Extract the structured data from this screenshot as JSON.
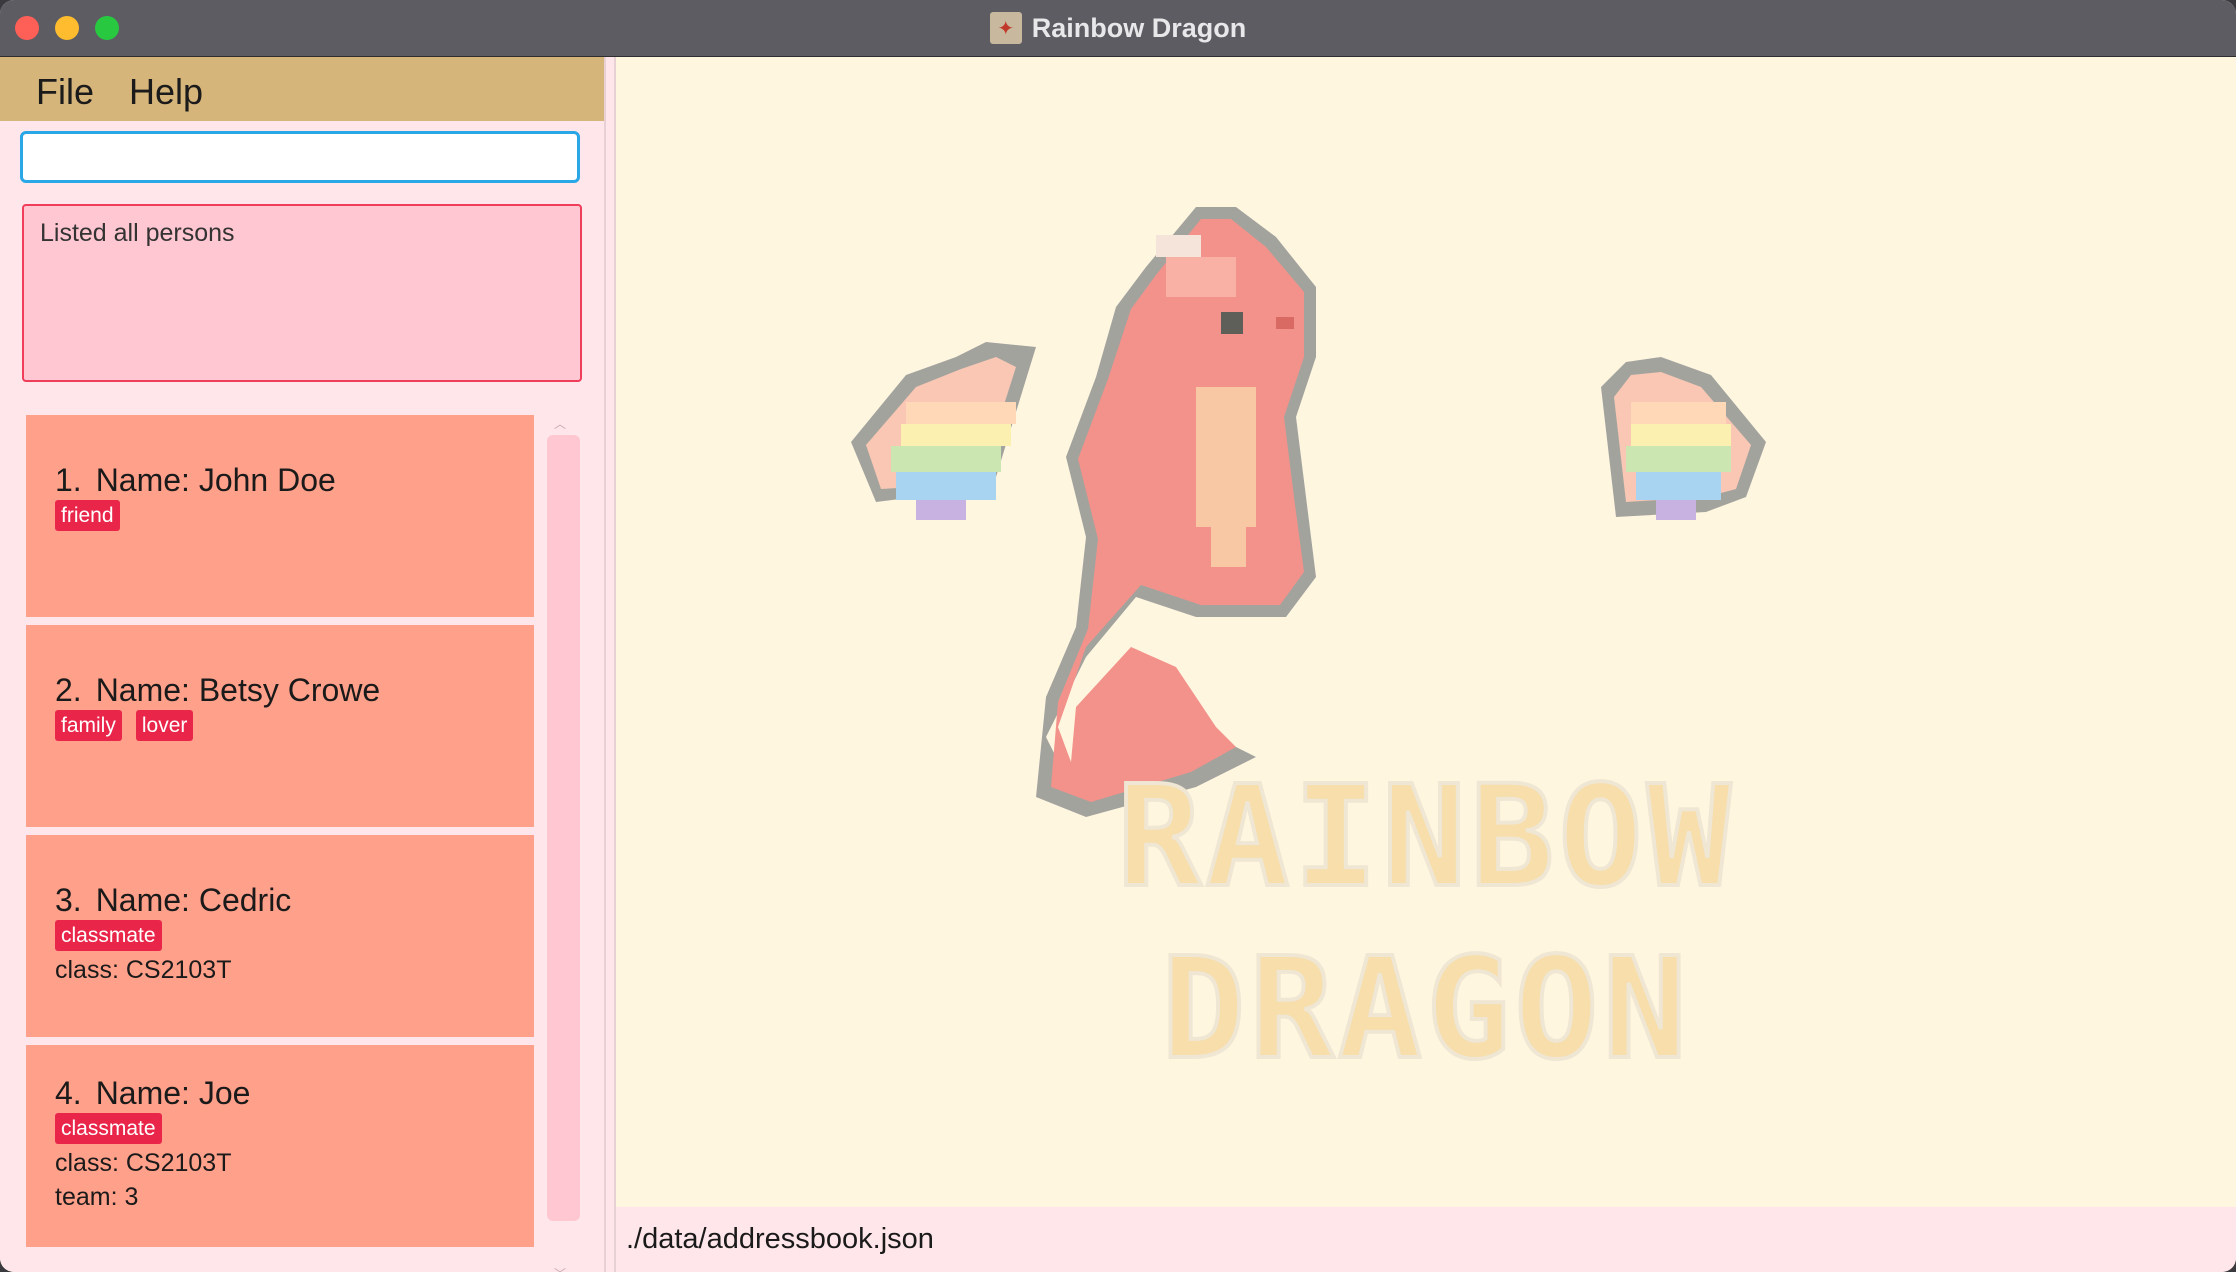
{
  "window": {
    "title": "Rainbow Dragon",
    "icon": "dragon-app-icon"
  },
  "menu": {
    "items": [
      "File",
      "Help"
    ]
  },
  "command_box": {
    "value": "",
    "placeholder": ""
  },
  "result_display": {
    "text": "Listed all persons"
  },
  "persons": [
    {
      "index": "1.",
      "name": "Name: John Doe",
      "tags": [
        "friend"
      ],
      "fields": []
    },
    {
      "index": "2.",
      "name": "Name: Betsy Crowe",
      "tags": [
        "family",
        "lover"
      ],
      "fields": []
    },
    {
      "index": "3.",
      "name": "Name: Cedric",
      "tags": [
        "classmate"
      ],
      "fields": [
        "class: CS2103T"
      ]
    },
    {
      "index": "4.",
      "name": "Name: Joe",
      "tags": [
        "classmate"
      ],
      "fields": [
        "class: CS2103T",
        "team: 3"
      ]
    }
  ],
  "logo": {
    "line1": "RAINBOW",
    "line2": "DRAGON"
  },
  "status_bar": {
    "path": "./data/addressbook.json"
  },
  "colors": {
    "menubar": "#d6b57a",
    "card": "#ffa08a",
    "tag": "#e9264a",
    "accent_input": "#29a7e6",
    "result_border": "#ef3d5a",
    "right_background": "#fff6e0",
    "left_background": "#ffe6ea"
  }
}
